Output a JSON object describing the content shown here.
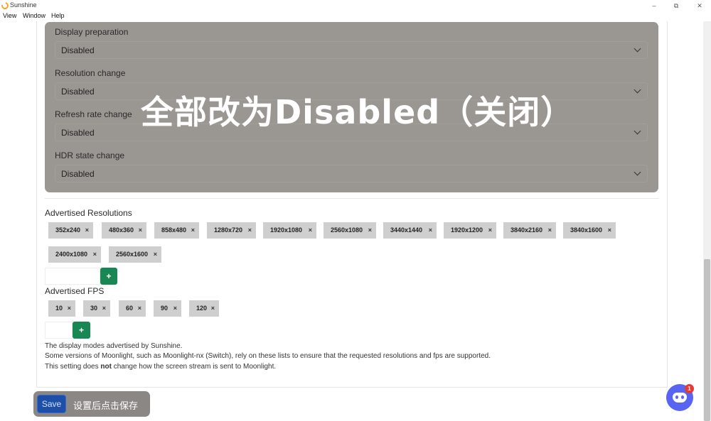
{
  "window": {
    "title": "Sunshine",
    "controls": {
      "minimize": "–",
      "maximize": "⧉",
      "close": "✕"
    }
  },
  "menu": [
    "View",
    "Window",
    "Help"
  ],
  "overlay": {
    "caption": "全部改为Disabled（关闭）",
    "fields": [
      {
        "label": "Display preparation",
        "value": "Disabled"
      },
      {
        "label": "Resolution change",
        "value": "Disabled"
      },
      {
        "label": "Refresh rate change",
        "value": "Disabled"
      },
      {
        "label": "HDR state change",
        "value": "Disabled"
      }
    ]
  },
  "resolutions": {
    "title": "Advertised Resolutions",
    "items": [
      "352x240",
      "480x360",
      "858x480",
      "1280x720",
      "1920x1080",
      "2560x1080",
      "3440x1440",
      "1920x1200",
      "3840x2160",
      "3840x1600",
      "2400x1080",
      "2560x1600"
    ],
    "add_label": "+"
  },
  "fps": {
    "title": "Advertised FPS",
    "items": [
      "10",
      "30",
      "60",
      "90",
      "120"
    ],
    "add_label": "+"
  },
  "description": {
    "line1": "The display modes advertised by Sunshine.",
    "line2": "Some versions of Moonlight, such as Moonlight-nx (Switch), rely on these lists to ensure that the requested resolutions and fps are supported.",
    "line3_pre": "This setting does ",
    "line3_bold": "not",
    "line3_post": " change how the screen stream is sent to Moonlight."
  },
  "chip_remove": "×",
  "save": {
    "label": "Save",
    "caption": "设置后点击保存"
  },
  "discord": {
    "badge": "1"
  },
  "colors": {
    "accent": "#198754",
    "save": "#1d4fa8",
    "discord": "#5865f2",
    "overlay": "#9a9692"
  }
}
